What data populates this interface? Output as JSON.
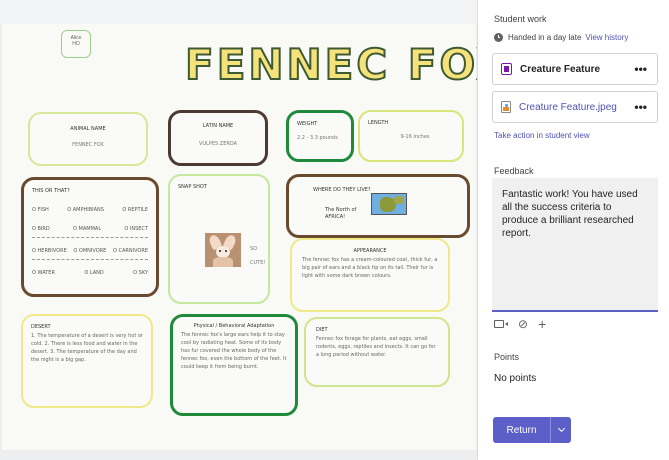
{
  "poster": {
    "name_tag": "Alice\nHO",
    "title": "FENNEC FOX",
    "animal_name": {
      "label": "ANIMAL NAME",
      "value": "FENNEC FOX"
    },
    "latin_name": {
      "label": "LATIN NAME",
      "value": "VULPES ZERDA"
    },
    "weight": {
      "label": "WEIGHT",
      "value": "2.2 - 3.3 pounds"
    },
    "length": {
      "label": "LENGTH",
      "value": "9-16 inches"
    },
    "this_or_that": {
      "label": "THIS OR THAT?",
      "rows": [
        [
          "O FISH",
          "O AMPHIBIANS",
          "O REPTILE"
        ],
        [
          "O BIRD",
          "O MAMMAL",
          "O INSECT"
        ],
        [
          "O HERBIVORE",
          "O OMNIVORE",
          "O CARNIVORE"
        ],
        [
          "O WATER",
          "O LAND",
          "O SKY"
        ]
      ]
    },
    "snapshot": {
      "label": "SNAP SHOT",
      "note": "SO\nCUTE!"
    },
    "where": {
      "label": "WHERE DO THEY LIVE?",
      "answer": "The North of\nAFRICA!"
    },
    "appearance": {
      "label": "APPEARANCE",
      "text": "The fennec fox has a cream-coloured coat, thick fur, a big pair of ears and a black tip on its tail. Their fur is light with some dark brown colours."
    },
    "desert": {
      "label": "DESERT",
      "text": "1. The temperature of a desert is very hot or cold. 2. There is less food and water in the desert. 3. The temperature of the day and the night is a big gap."
    },
    "physical": {
      "label": "Physical / Behavioral Adaptation",
      "text": "The fennec fox's large ears help it to stay cool by radiating heat. Some of its body has fur covered the whole body of the fennec fox, even the bottom of the feet. It could keep it from being burnt."
    },
    "diet": {
      "label": "DIET",
      "text": "Fennec fox forage for plants, eat eggs, small rodents, eggs, reptiles and insects. It can go for a long period without water."
    }
  },
  "panel": {
    "student_work_heading": "Student work",
    "handed_in": "Handed in a day late",
    "view_history": "View history",
    "files": [
      {
        "name": "Creature Feature",
        "icon": "onenote-icon",
        "menu": "•••"
      },
      {
        "name": "Creature Feature.jpeg",
        "icon": "image-file-icon",
        "menu": "•••"
      }
    ],
    "take_action": "Take action in student view",
    "feedback_heading": "Feedback",
    "feedback_text": "Fantastic work! You have used all the success criteria to produce a brilliant researched report.",
    "points_heading": "Points",
    "points_value": "No points",
    "return_label": "Return"
  },
  "colors": {
    "accent": "#5b5fc7",
    "link": "#4f52b2",
    "poster_title_fill": "#f6e27a"
  }
}
